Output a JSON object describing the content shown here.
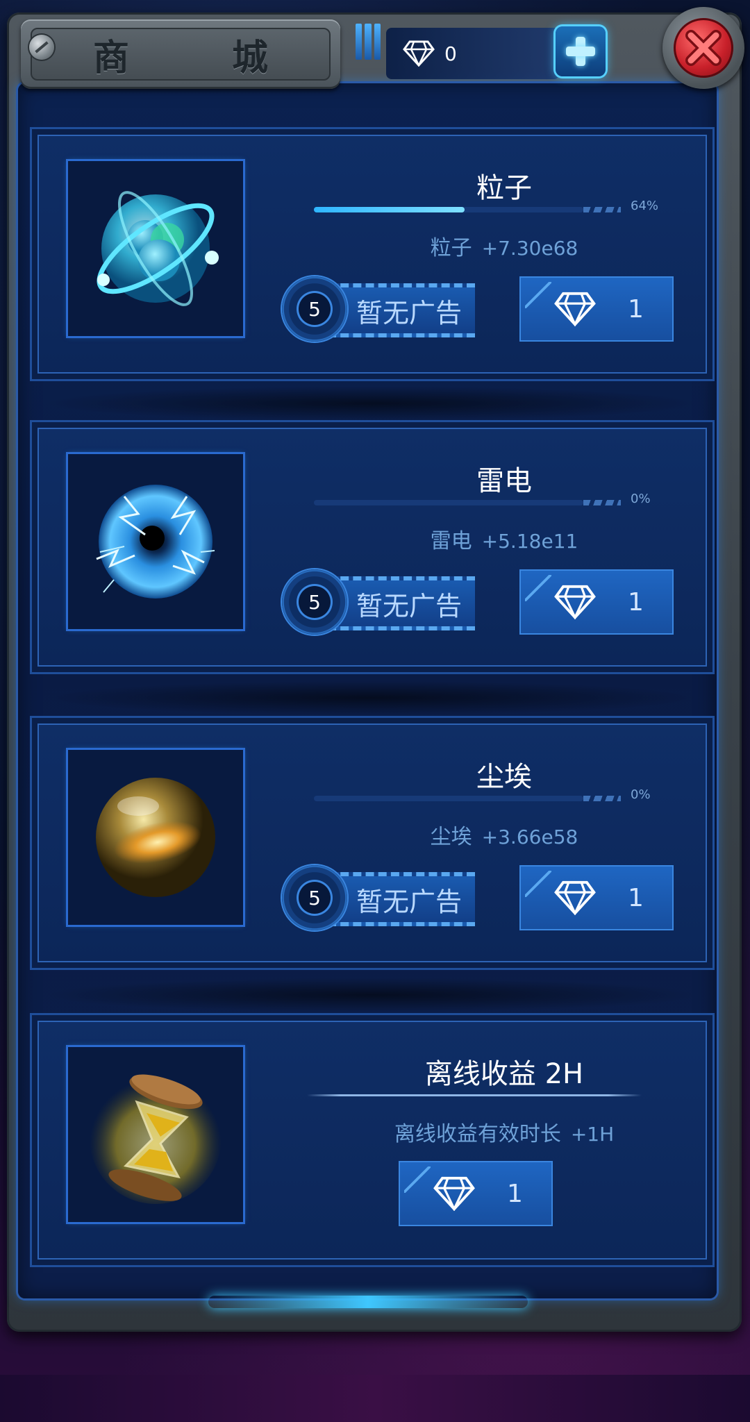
{
  "header": {
    "title": "商　城",
    "gems": "0",
    "icons": {
      "gem": "diamond-icon",
      "plus": "plus-icon",
      "close": "close-icon"
    }
  },
  "items": [
    {
      "name": "粒子",
      "icon": "particle-orb-icon",
      "progress_percent": 64,
      "progress_label": "64%",
      "resource": "粒子",
      "gain": "+7.30e68",
      "ad_count": "5",
      "ad_label": "暂无广告",
      "cost": "1"
    },
    {
      "name": "雷电",
      "icon": "lightning-orb-icon",
      "progress_percent": 0,
      "progress_label": "0%",
      "resource": "雷电",
      "gain": "+5.18e11",
      "ad_count": "5",
      "ad_label": "暂无广告",
      "cost": "1"
    },
    {
      "name": "尘埃",
      "icon": "dust-orb-icon",
      "progress_percent": 0,
      "progress_label": "0%",
      "resource": "尘埃",
      "gain": "+3.66e58",
      "ad_count": "5",
      "ad_label": "暂无广告",
      "cost": "1"
    }
  ],
  "offline": {
    "title": "离线收益 2H",
    "icon": "hourglass-icon",
    "desc": "离线收益有效时长",
    "gain": "+1H",
    "cost": "1"
  },
  "colors": {
    "accent": "#3fc7ff",
    "panel": "#0c2658",
    "close": "#c8202a"
  }
}
